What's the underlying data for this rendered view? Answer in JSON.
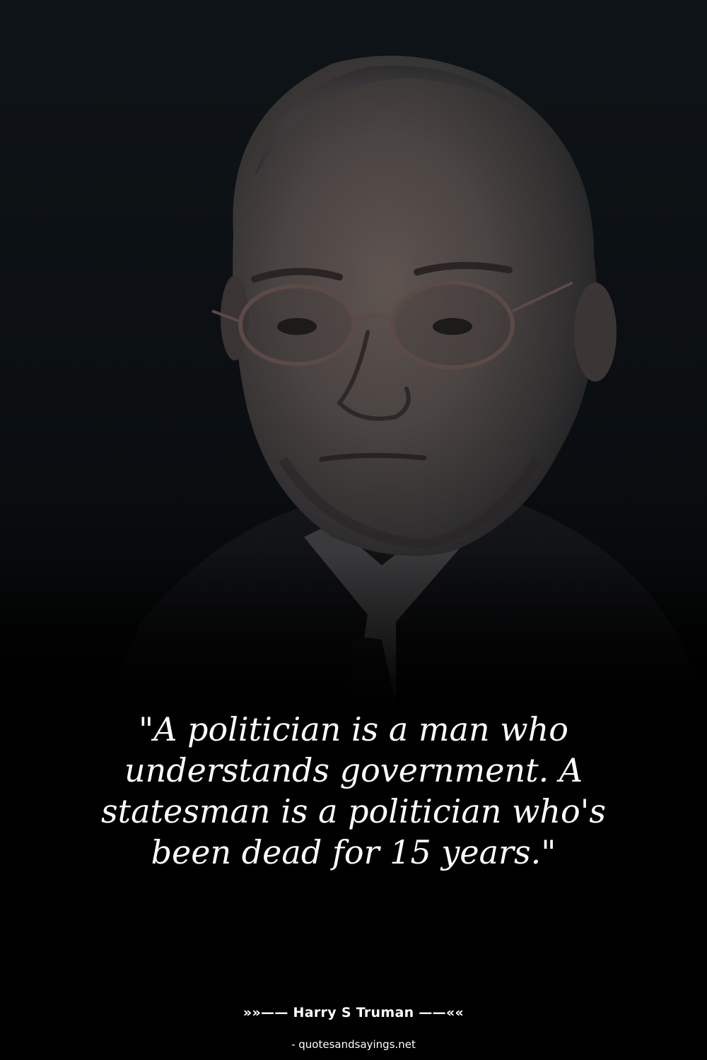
{
  "quote_text": "\"A politician is a man who understands government. A statesman is a politician who's been dead for 15 years.\"",
  "author_line": "»»—— Harry S Truman ——««",
  "source_line": "- quotesandsayings.net",
  "colors": {
    "background": "#000000",
    "text": "#ffffff"
  }
}
